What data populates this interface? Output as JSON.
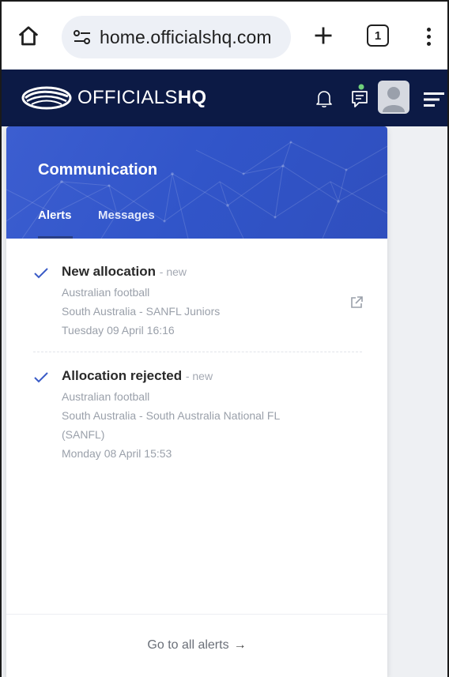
{
  "browser": {
    "url": "home.officialshq.com",
    "tab_count": "1"
  },
  "app": {
    "brand_light": "OFFICIALS",
    "brand_bold": "HQ"
  },
  "panel": {
    "title": "Communication",
    "tabs": [
      {
        "label": "Alerts",
        "active": true
      },
      {
        "label": "Messages",
        "active": false
      }
    ],
    "alerts": [
      {
        "title": "New allocation",
        "status": "- new",
        "lines": [
          "Australian football",
          "South Australia - SANFL Juniors",
          "Tuesday 09 April 16:16"
        ]
      },
      {
        "title": "Allocation rejected",
        "status": "- new",
        "lines": [
          "Australian football",
          "South Australia - South Australia National FL",
          "(SANFL)",
          "Monday 08 April 15:53"
        ]
      }
    ],
    "footer_link": "Go to all alerts",
    "footer_arrow": "→"
  },
  "colors": {
    "header_navy": "#0c1a45",
    "panel_blue": "#3155c9",
    "check_blue": "#3a5bc7",
    "notification_dot": "#6fcf7a"
  }
}
